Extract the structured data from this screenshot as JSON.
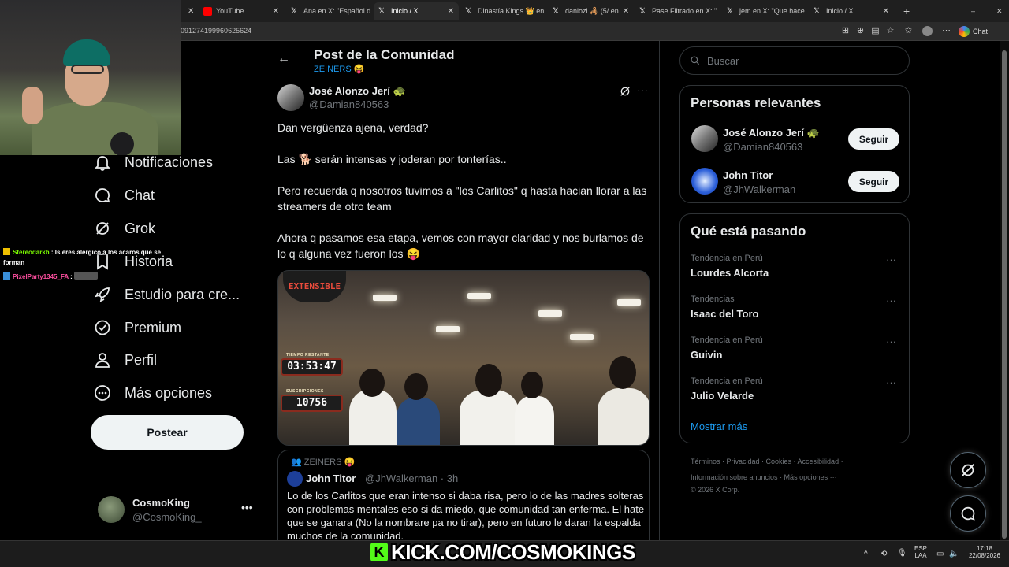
{
  "browser": {
    "tabs": [
      {
        "label": "YouTube",
        "icon": "youtube-icon"
      },
      {
        "label": "Ana en X: \"Español d",
        "icon": "x-logo-icon"
      },
      {
        "label": "Inicio / X",
        "icon": "x-logo-icon"
      },
      {
        "label": "Dinastía Kings 👑 en",
        "icon": "x-logo-icon"
      },
      {
        "label": "daniozi 🦂 (5/ en",
        "icon": "x-logo-icon"
      },
      {
        "label": "Pase Filtrado en X: \"",
        "icon": "x-logo-icon"
      },
      {
        "label": "jem en X: \"Que hace",
        "icon": "x-logo-icon"
      },
      {
        "label": "Inicio / X",
        "icon": "x-logo-icon"
      }
    ],
    "url_fragment": "091274199960625624",
    "chat_button": "Chat"
  },
  "nav": {
    "items": [
      {
        "label": "Notificaciones",
        "icon": "bell-icon"
      },
      {
        "label": "Chat",
        "icon": "chat-bubble-icon"
      },
      {
        "label": "Grok",
        "icon": "grok-icon"
      },
      {
        "label": "Historia",
        "icon": "bookmark-icon"
      },
      {
        "label": "Estudio para cre...",
        "icon": "rocket-icon"
      },
      {
        "label": "Premium",
        "icon": "verified-badge-icon"
      },
      {
        "label": "Perfil",
        "icon": "person-icon"
      },
      {
        "label": "Más opciones",
        "icon": "more-circle-icon"
      }
    ],
    "post_button": "Postear",
    "account": {
      "name": "CosmoKing",
      "handle": "@CosmoKing_"
    }
  },
  "post": {
    "header_title": "Post de la Comunidad",
    "community": "ZEINERS 😝",
    "author_name": "José Alonzo Jerí 🐢",
    "author_handle": "@Damian840563",
    "paragraphs": [
      "Dan vergüenza ajena, verdad?",
      "Las 🐕 serán intensas y joderan por tonterías..",
      "Pero recuerda q nosotros tuvimos a \"los Carlitos\" q hasta hacian llorar a las streamers de otro team",
      "Ahora q pasamos esa etapa, vemos con mayor claridad y nos burlamos de lo q alguna vez fueron los 😝"
    ],
    "media": {
      "overlay_title": "EXTENSIBLE",
      "timer_label": "TIEMPO RESTANTE",
      "timer_value": "03:53:47",
      "subs_label": "SUSCRIPCIONES",
      "subs_value": "10756"
    },
    "quote": {
      "community": "👥 ZEINERS 😝",
      "name": "John Titor",
      "handle": "@JhWalkerman · 3h",
      "text": "Lo de los Carlitos que eran intenso si daba risa, pero lo de las madres solteras con problemas mentales eso si da miedo, que comunidad tan enferma. El hate que se ganara (No la nombrare pa no tirar), pero en futuro le daran la espalda muchos de la comunidad."
    }
  },
  "sidebar": {
    "search_placeholder": "Buscar",
    "relevant_title": "Personas relevantes",
    "relevant": [
      {
        "name": "José Alonzo Jerí 🐢",
        "handle": "@Damian840563",
        "button": "Seguir"
      },
      {
        "name": "John Titor",
        "handle": "@JhWalkerman",
        "button": "Seguir"
      }
    ],
    "trends_title": "Qué está pasando",
    "trends": [
      {
        "context": "Tendencia en Perú",
        "name": "Lourdes Alcorta"
      },
      {
        "context": "Tendencias",
        "name": "Isaac del Toro"
      },
      {
        "context": "Tendencia en Perú",
        "name": "Guivin"
      },
      {
        "context": "Tendencia en Perú",
        "name": "Julio Velarde"
      }
    ],
    "show_more": "Mostrar más",
    "footer": {
      "line1": "Términos · Privacidad · Cookies · Accesibilidad ·",
      "line2": "Información sobre anuncios · Más opciones ···",
      "line3": "© 2026 X Corp."
    }
  },
  "stream": {
    "chat": [
      {
        "user": "Stereodarkh",
        "text": ": Is eres alergico a los acaros que se forman",
        "color": "#7cfc00"
      },
      {
        "user": "PixelParty1345_FA",
        "text": ":",
        "color": "#ff4fa0"
      }
    ],
    "kick_banner": "KICK.COM/COSMOKINGS",
    "kick_color": "#53fc18"
  },
  "taskbar": {
    "lang_top": "ESP",
    "lang_bottom": "LAA",
    "time": "17:18",
    "date": "22/08/2026"
  }
}
